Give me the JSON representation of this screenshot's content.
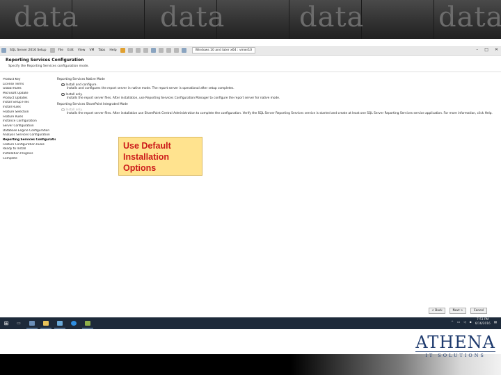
{
  "banner": {
    "word": "data"
  },
  "toolbar": {
    "app_title": "SQL Server 2016 Setup",
    "menus": [
      "File",
      "Edit",
      "View",
      "VM",
      "Tabs",
      "Help"
    ],
    "window_tab": "Windows 10 and later x64 : vmwr10",
    "min_symbol": "–",
    "max_symbol": "□",
    "close_symbol": "✕"
  },
  "dialog": {
    "title": "Reporting Services Configuration",
    "subtitle": "Specify the Reporting Services configuration mode."
  },
  "nav": {
    "items": [
      "Product Key",
      "License Terms",
      "Global Rules",
      "Microsoft Update",
      "Product Updates",
      "Install Setup Files",
      "Install Rules",
      "Feature Selection",
      "Feature Rules",
      "Instance Configuration",
      "Server Configuration",
      "Database Engine Configuration",
      "Analysis Services Configuration",
      "Reporting Services Configuratio...",
      "Feature Configuration Rules",
      "Ready to Install",
      "Installation Progress",
      "Complete"
    ],
    "active_index": 13
  },
  "content": {
    "native_heading": "Reporting Services Native Mode",
    "install_configure_label": "Install and configure.",
    "install_configure_desc": "Installs and configures the report server in native mode. The report server is operational after setup completes.",
    "install_only_label": "Install only.",
    "install_only_desc": "Installs the report server files. After installation, use Reporting Services Configuration Manager to configure the report server for native mode.",
    "sharepoint_heading": "Reporting Services SharePoint Integrated Mode",
    "sp_install_only_label": "Install only.",
    "sp_install_only_desc": "Installs the report server files. After installation use SharePoint Central Administration to complete the configuration. Verify the SQL Server Reporting Services service is started and create at least one SQL Server Reporting Services service application. For more information, click Help."
  },
  "buttons": {
    "back": "< Back",
    "next": "Next >",
    "cancel": "Cancel"
  },
  "taskbar": {
    "start_symbol": "⊞",
    "time": "7:51 PM",
    "date": "6/16/2016"
  },
  "callout": {
    "text": "Use Default\nInstallation\nOptions"
  },
  "logo": {
    "name": "ATHENA",
    "tagline": "IT SOLUTIONS"
  }
}
